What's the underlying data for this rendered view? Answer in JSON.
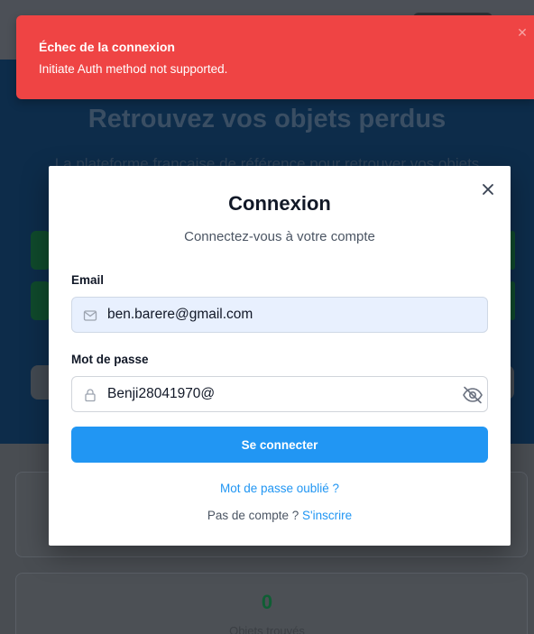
{
  "background": {
    "hero_title": "Retrouvez vos objets perdus",
    "hero_subtitle": "La plateforme française de référence pour retrouver vos objets",
    "stat_value": "0",
    "stat_label": "Objets trouvés"
  },
  "toast": {
    "title": "Échec de la connexion",
    "message": "Initiate Auth method not supported.",
    "close_icon": "close-icon",
    "color": "#ef4444"
  },
  "modal": {
    "title": "Connexion",
    "subtitle": "Connectez-vous à votre compte",
    "close_icon": "close-icon",
    "email": {
      "label": "Email",
      "value": "ben.barere@gmail.com",
      "icon": "mail-icon"
    },
    "password": {
      "label": "Mot de passe",
      "value": "Benji28041970@",
      "icon": "lock-icon",
      "toggle_icon": "eye-off-icon"
    },
    "submit_label": "Se connecter",
    "forgot_label": "Mot de passe oublié ?",
    "no_account_text": "Pas de compte ?",
    "signup_label": "S'inscrire",
    "accent_color": "#2196f3"
  }
}
